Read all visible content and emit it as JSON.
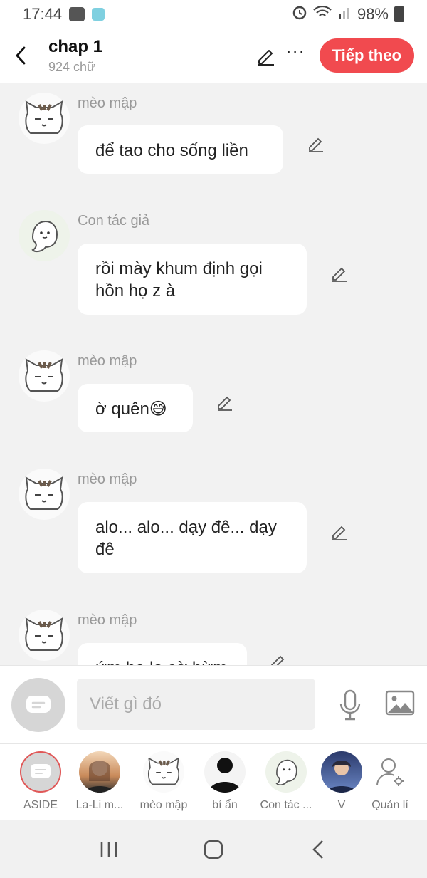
{
  "status": {
    "time": "17:44",
    "battery": "98%"
  },
  "header": {
    "title": "chap 1",
    "word_count": "924 chữ",
    "next_label": "Tiếp theo",
    "more": "···"
  },
  "messages": [
    {
      "author": "mèo mập",
      "text": "để tao cho sống liền"
    },
    {
      "author": "Con tác giả",
      "text": "rồi mày khum định gọi hồn họ z à"
    },
    {
      "author": "mèo mập",
      "text": "ờ quên😅"
    },
    {
      "author": "mèo mập",
      "text": "alo... alo... dạy đê... dạy đê"
    },
    {
      "author": "mèo mập",
      "text": "ứm be lo cờ hừm"
    }
  ],
  "input": {
    "placeholder": "Viết gì đó"
  },
  "characters": [
    {
      "label": "ASIDE"
    },
    {
      "label": "La-Li m..."
    },
    {
      "label": "mèo mập"
    },
    {
      "label": "bí ẩn"
    },
    {
      "label": "Con tác ..."
    },
    {
      "label": "V"
    },
    {
      "label": "Quản lí"
    }
  ],
  "colors": {
    "accent": "#f14a4f",
    "background": "#f2f2f2",
    "bubble": "#ffffff"
  }
}
